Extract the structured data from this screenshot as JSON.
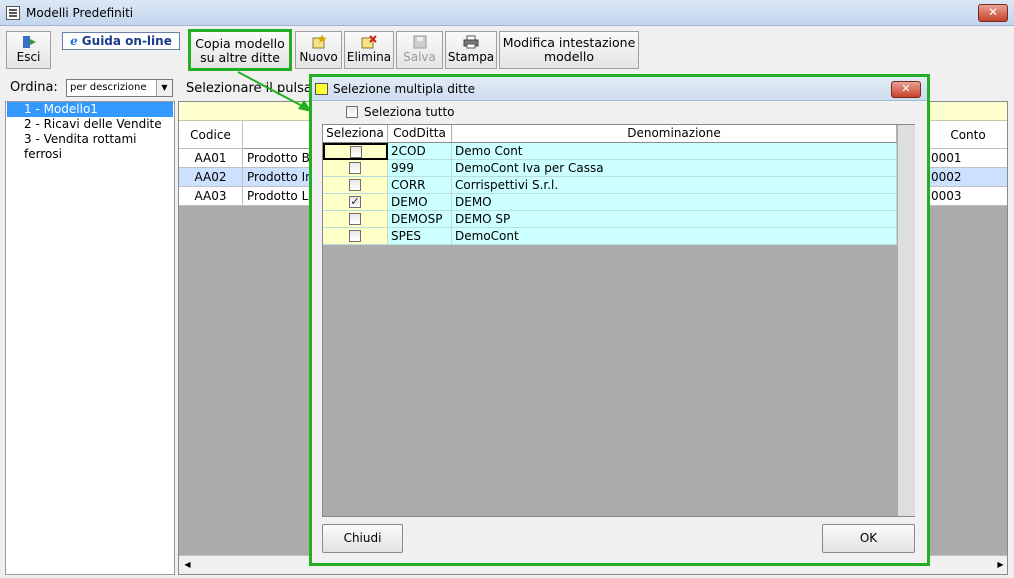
{
  "window": {
    "title": "Modelli Predefiniti",
    "close_glyph": "✕"
  },
  "toolbar": {
    "exit_label": "Esci",
    "guide_label": "Guida on-line",
    "guide_icon_letter": "e",
    "copy_line1": "Copia modello",
    "copy_line2": "su altre ditte",
    "new_label": "Nuovo",
    "delete_label": "Elimina",
    "save_label": "Salva",
    "print_label": "Stampa",
    "header_line1": "Modifica intestazione",
    "header_line2": "modello"
  },
  "sort": {
    "label": "Ordina:",
    "value": "per descrizione"
  },
  "model_list": [
    "1 - Modello1",
    "2 - Ricavi delle Vendite",
    "3 - Vendita rottami ferrosi"
  ],
  "hint_text": "Selezionare il pulsa",
  "main_table": {
    "headers": {
      "code": "Codice",
      "account": "Conto"
    },
    "rows": [
      {
        "code": "AA01",
        "desc": "Prodotto Ba",
        "account": "0001"
      },
      {
        "code": "AA02",
        "desc": "Prodotto In",
        "account": "0002"
      },
      {
        "code": "AA03",
        "desc": "Prodotto La",
        "account": "0003"
      }
    ]
  },
  "dialog": {
    "title": "Selezione multipla ditte",
    "select_all_label": "Seleziona tutto",
    "columns": [
      "Seleziona",
      "CodDitta",
      "Denominazione"
    ],
    "rows": [
      {
        "selected": false,
        "code": "2COD",
        "name": "Demo Cont"
      },
      {
        "selected": false,
        "code": "999",
        "name": "DemoCont Iva per Cassa"
      },
      {
        "selected": false,
        "code": "CORR",
        "name": "Corrispettivi S.r.l."
      },
      {
        "selected": true,
        "code": "DEMO",
        "name": "DEMO"
      },
      {
        "selected": false,
        "code": "DEMOSP",
        "name": "DEMO SP"
      },
      {
        "selected": false,
        "code": "SPES",
        "name": "DemoCont"
      }
    ],
    "close_label": "Chiudi",
    "ok_label": "OK",
    "close_glyph": "✕"
  },
  "colors": {
    "highlight_green": "#22b022",
    "selection_blue": "#3399ff",
    "row_cyan": "#ccffff",
    "cell_yellow": "#ffffc8"
  }
}
